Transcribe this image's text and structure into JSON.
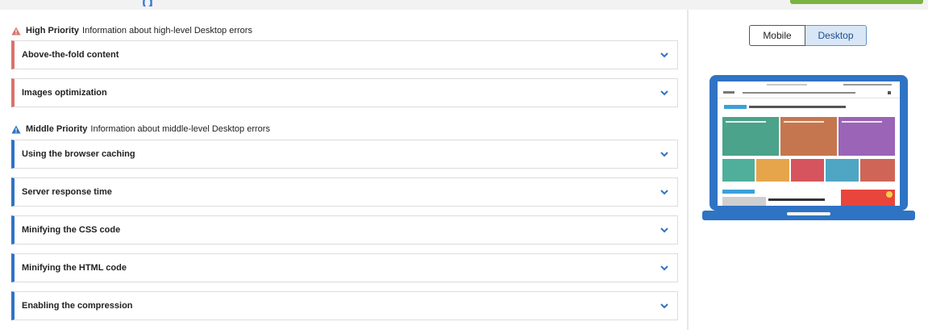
{
  "header": {
    "title_fragment": "g",
    "accent": "#3a7bd5",
    "action_color": "#7cb342"
  },
  "high_priority": {
    "title": "High Priority",
    "description": "Information about high-level Desktop errors",
    "color": "#d9736c",
    "items": [
      {
        "label": "Above-the-fold content"
      },
      {
        "label": "Images optimization"
      }
    ]
  },
  "middle_priority": {
    "title": "Middle Priority",
    "description": "Information about middle-level Desktop errors",
    "color": "#2f73c4",
    "items": [
      {
        "label": "Using the browser caching"
      },
      {
        "label": "Server response time"
      },
      {
        "label": "Minifying the CSS code"
      },
      {
        "label": "Minifying the HTML code"
      },
      {
        "label": "Enabling the compression"
      }
    ]
  },
  "preview": {
    "toggle": {
      "mobile_label": "Mobile",
      "desktop_label": "Desktop",
      "selected": "Desktop"
    },
    "device": "laptop",
    "frame_color": "#2f73c4"
  }
}
